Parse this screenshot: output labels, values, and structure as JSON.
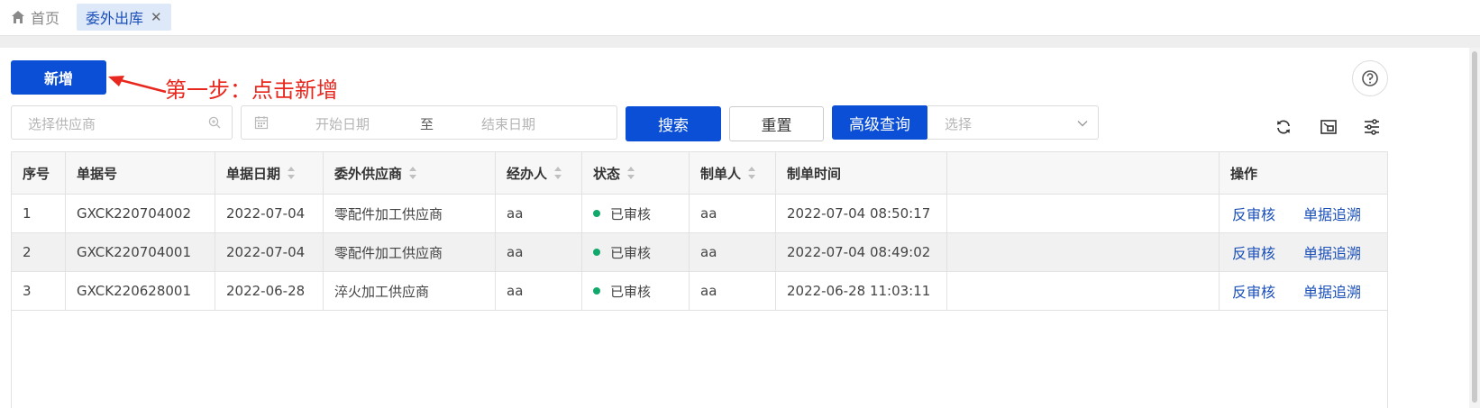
{
  "tabs": {
    "home_label": "首页",
    "active_label": "委外出库"
  },
  "toolbar": {
    "add_label": "新增",
    "annotation": "第一步：点击新增",
    "annotation_color": "#e8281e"
  },
  "filters": {
    "supplier_placeholder": "选择供应商",
    "start_date_placeholder": "开始日期",
    "date_separator": "至",
    "end_date_placeholder": "结束日期",
    "search_label": "搜索",
    "reset_label": "重置",
    "advanced_label": "高级查询",
    "advanced_select_placeholder": "选择"
  },
  "table": {
    "columns": [
      "序号",
      "单据号",
      "单据日期",
      "委外供应商",
      "经办人",
      "状态",
      "制单人",
      "制单时间",
      "",
      "操作"
    ],
    "rows": [
      {
        "no": "1",
        "doc": "GXCK220704002",
        "date": "2022-07-04",
        "supplier": "零配件加工供应商",
        "handler": "aa",
        "status": "已审核",
        "creator": "aa",
        "created": "2022-07-04 08:50:17",
        "action1": "反审核",
        "action2": "单据追溯"
      },
      {
        "no": "2",
        "doc": "GXCK220704001",
        "date": "2022-07-04",
        "supplier": "零配件加工供应商",
        "handler": "aa",
        "status": "已审核",
        "creator": "aa",
        "created": "2022-07-04 08:49:02",
        "action1": "反审核",
        "action2": "单据追溯"
      },
      {
        "no": "3",
        "doc": "GXCK220628001",
        "date": "2022-06-28",
        "supplier": "淬火加工供应商",
        "handler": "aa",
        "status": "已审核",
        "creator": "aa",
        "created": "2022-06-28 11:03:11",
        "action1": "反审核",
        "action2": "单据追溯"
      }
    ]
  },
  "colors": {
    "primary": "#0a4fd6",
    "link": "#1a4fb8",
    "status_ok": "#13a86b"
  },
  "icons": [
    "home-icon",
    "close-icon",
    "help-icon",
    "search-icon",
    "calendar-icon",
    "chevron-down-icon",
    "refresh-icon",
    "fullscreen-icon",
    "settings-icon",
    "sort-icon"
  ]
}
